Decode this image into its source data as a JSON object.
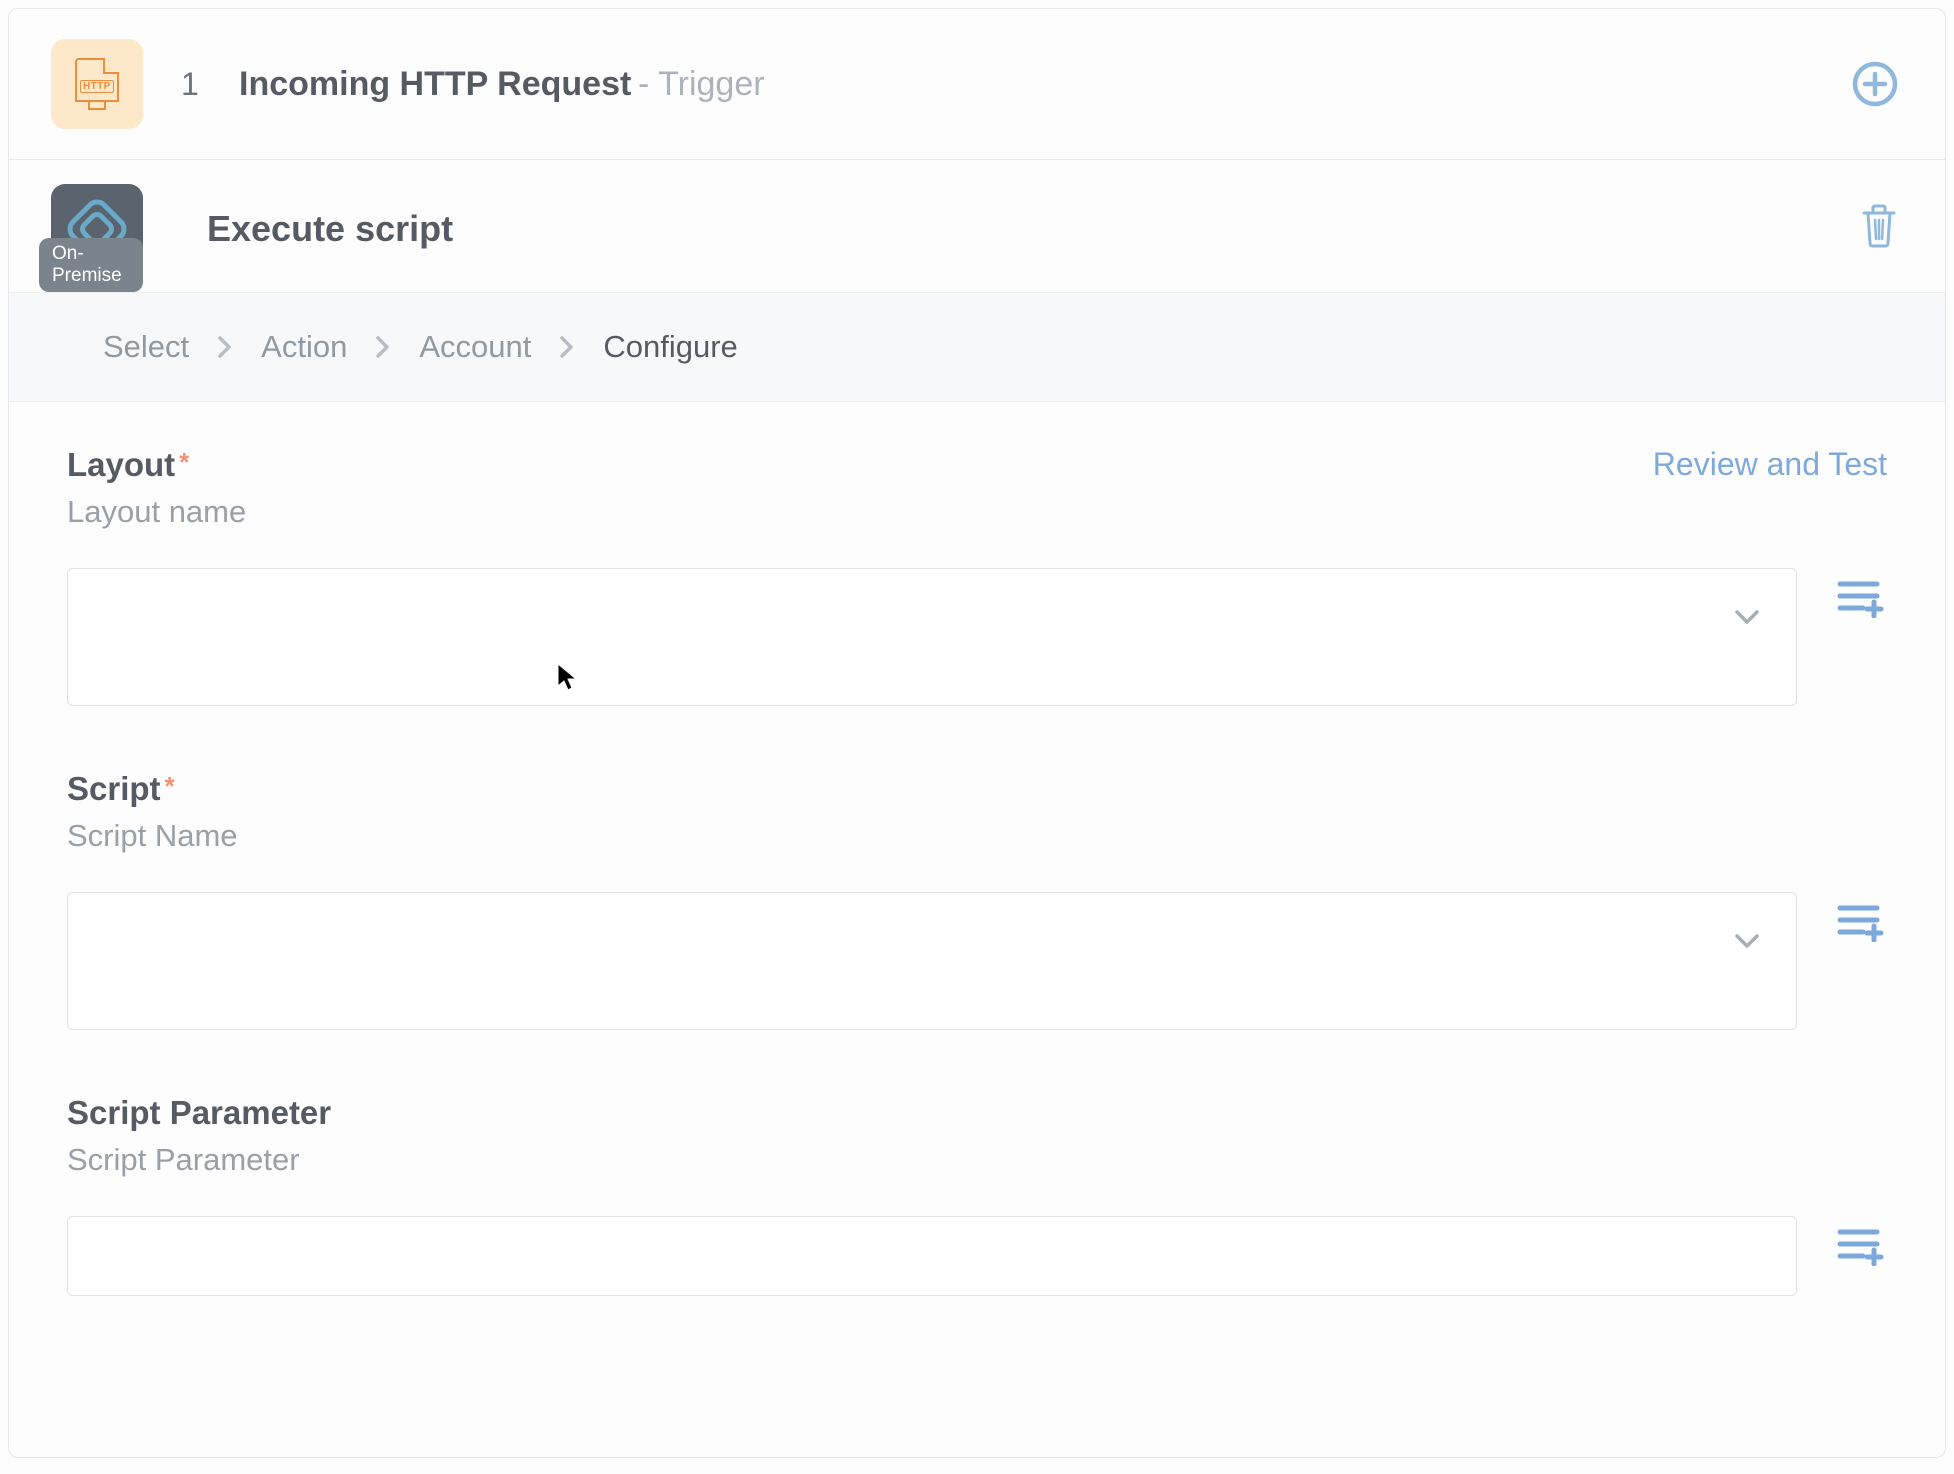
{
  "trigger": {
    "step_number": "1",
    "title": "Incoming HTTP Request",
    "suffix": "- Trigger"
  },
  "step": {
    "title": "Execute script",
    "badge": "On-Premise"
  },
  "breadcrumb": {
    "items": [
      {
        "label": "Select"
      },
      {
        "label": "Action"
      },
      {
        "label": "Account"
      },
      {
        "label": "Configure"
      }
    ],
    "active_index": 3
  },
  "review_link": "Review and Test",
  "fields": {
    "layout": {
      "title": "Layout",
      "required": true,
      "sub": "Layout name",
      "value": ""
    },
    "script": {
      "title": "Script",
      "required": true,
      "sub": "Script Name",
      "value": ""
    },
    "script_parameter": {
      "title": "Script Parameter",
      "required": false,
      "sub": "Script Parameter",
      "value": ""
    }
  }
}
